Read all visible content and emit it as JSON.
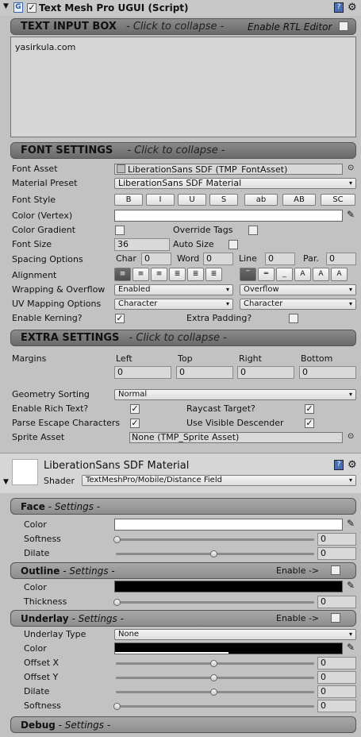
{
  "component": {
    "title": "Text Mesh Pro UGUI (Script)",
    "help_icon": "help-book-icon",
    "settings_icon": "gear-icon"
  },
  "text_input": {
    "header": "TEXT INPUT BOX",
    "collapse": "- Click to collapse -",
    "rtl_label": "Enable RTL Editor",
    "value": "yasirkula.com"
  },
  "font_settings": {
    "header": "FONT SETTINGS",
    "collapse": "- Click to collapse -",
    "font_asset_label": "Font Asset",
    "font_asset_value": "LiberationSans SDF (TMP_FontAsset)",
    "material_preset_label": "Material Preset",
    "material_preset_value": "LiberationSans SDF Material",
    "font_style_label": "Font Style",
    "styles": [
      "B",
      "I",
      "U",
      "S",
      "ab",
      "AB",
      "SC"
    ],
    "color_label": "Color (Vertex)",
    "gradient_label": "Color Gradient",
    "override_tags_label": "Override Tags",
    "font_size_label": "Font Size",
    "font_size_value": "36",
    "auto_size_label": "Auto Size",
    "spacing_label": "Spacing Options",
    "spacing": [
      {
        "label": "Char",
        "value": "0"
      },
      {
        "label": "Word",
        "value": "0"
      },
      {
        "label": "Line",
        "value": "0"
      },
      {
        "label": "Par.",
        "value": "0"
      }
    ],
    "alignment_label": "Alignment",
    "wrapping_label": "Wrapping & Overflow",
    "wrapping_value": "Enabled",
    "overflow_value": "Overflow",
    "uv_label": "UV Mapping Options",
    "uv_h_value": "Character",
    "uv_v_value": "Character",
    "kerning_label": "Enable Kerning?",
    "extra_padding_label": "Extra Padding?"
  },
  "extra_settings": {
    "header": "EXTRA SETTINGS",
    "collapse": "- Click to collapse -",
    "margins_label": "Margins",
    "margins": [
      {
        "label": "Left",
        "value": "0"
      },
      {
        "label": "Top",
        "value": "0"
      },
      {
        "label": "Right",
        "value": "0"
      },
      {
        "label": "Bottom",
        "value": "0"
      }
    ],
    "geometry_label": "Geometry Sorting",
    "geometry_value": "Normal",
    "rich_text_label": "Enable Rich Text?",
    "raycast_label": "Raycast Target?",
    "parse_escape_label": "Parse Escape Characters",
    "visible_descender_label": "Use Visible Descender",
    "sprite_asset_label": "Sprite Asset",
    "sprite_asset_value": "None (TMP_Sprite Asset)"
  },
  "material": {
    "name": "LiberationSans SDF Material",
    "shader_label": "Shader",
    "shader_value": "TextMeshPro/Mobile/Distance Field"
  },
  "face": {
    "title": "Face",
    "sub": "- Settings -",
    "color_label": "Color",
    "softness_label": "Softness",
    "softness_value": "0",
    "dilate_label": "Dilate",
    "dilate_value": "0"
  },
  "outline": {
    "title": "Outline",
    "sub": "- Settings -",
    "enable_label": "Enable ->",
    "color_label": "Color",
    "thickness_label": "Thickness",
    "thickness_value": "0"
  },
  "underlay": {
    "title": "Underlay",
    "sub": "- Settings -",
    "enable_label": "Enable ->",
    "type_label": "Underlay Type",
    "type_value": "None",
    "color_label": "Color",
    "offset_x_label": "Offset X",
    "offset_x_value": "0",
    "offset_y_label": "Offset Y",
    "offset_y_value": "0",
    "dilate_label": "Dilate",
    "dilate_value": "0",
    "softness_label": "Softness",
    "softness_value": "0"
  },
  "debug": {
    "title": "Debug",
    "sub": "- Settings -"
  }
}
